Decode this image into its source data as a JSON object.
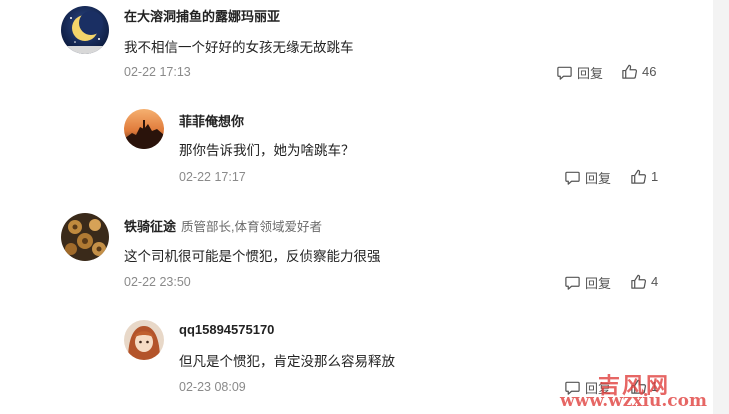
{
  "comments": [
    {
      "username": "在大溶洞捕鱼的露娜玛丽亚",
      "tag": "",
      "content": "我不相信一个好好的女孩无缘无故跳车",
      "time": "02-22 17:13",
      "reply_label": "回复",
      "likes": "46",
      "avatar": "moon-night-avatar"
    },
    {
      "username": "菲菲俺想你",
      "tag": "",
      "content": "那你告诉我们，她为啥跳车？",
      "time": "02-22 17:17",
      "reply_label": "回复",
      "likes": "1",
      "avatar": "sunset-silhouette-avatar"
    },
    {
      "username": "铁骑征途",
      "tag": "质管部长,体育领域爱好者",
      "content": "这个司机很可能是个惯犯，反侦察能力很强",
      "time": "02-22 23:50",
      "reply_label": "回复",
      "likes": "4",
      "avatar": "golden-figures-avatar"
    },
    {
      "username": "qq15894575170",
      "tag": "",
      "content": "但凡是个惯犯，肯定没那么容易释放",
      "time": "02-23 08:09",
      "reply_label": "回复",
      "likes": "1",
      "avatar": "anime-girl-avatar"
    }
  ],
  "watermark": {
    "line1": "吉风网",
    "line2": "www.wzxiu.com"
  },
  "colors": {
    "text": "#222222",
    "muted": "#8a8a8a",
    "watermark": "#e0403e"
  }
}
